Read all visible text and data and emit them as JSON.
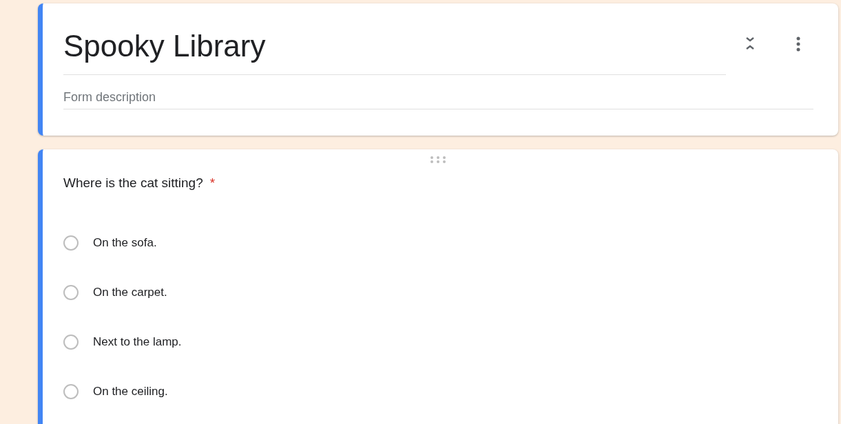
{
  "form": {
    "title": "Spooky Library",
    "description_placeholder": "Form description"
  },
  "question": {
    "text": "Where is the cat sitting?",
    "required": true,
    "required_mark": "*",
    "options": [
      {
        "label": "On the sofa.",
        "selected": false
      },
      {
        "label": "On the carpet.",
        "selected": false
      },
      {
        "label": "Next to the lamp.",
        "selected": false
      },
      {
        "label": "On the ceiling.",
        "selected": false
      }
    ]
  }
}
